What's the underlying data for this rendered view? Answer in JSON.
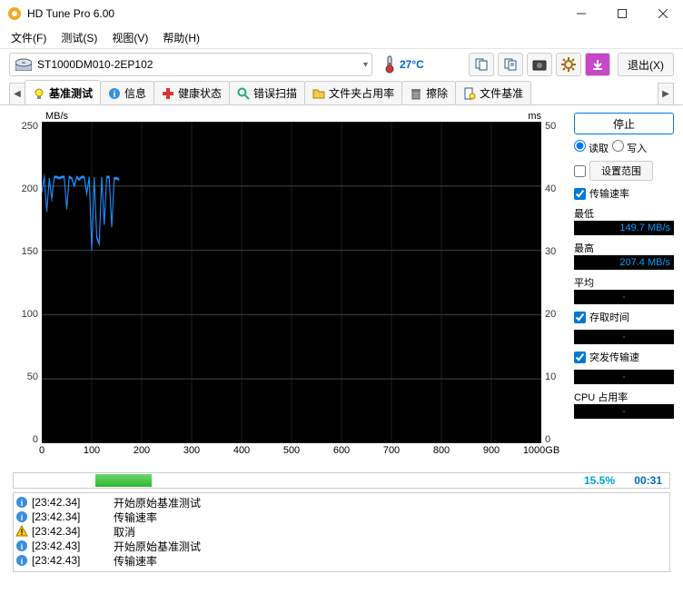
{
  "window": {
    "title": "HD Tune Pro 6.00"
  },
  "menu": [
    "文件(F)",
    "测试(S)",
    "视图(V)",
    "帮助(H)"
  ],
  "drive": "ST1000DM010-2EP102",
  "temperature": "27°C",
  "exit": "退出(X)",
  "tabs": [
    {
      "label": "基准测试",
      "active": true
    },
    {
      "label": "信息"
    },
    {
      "label": "健康状态"
    },
    {
      "label": "错误扫描"
    },
    {
      "label": "文件夹占用率"
    },
    {
      "label": "擦除"
    },
    {
      "label": "文件基准"
    }
  ],
  "chart": {
    "unit_left": "MB/s",
    "unit_right": "ms",
    "unit_x": "GB",
    "y_left": [
      "250",
      "200",
      "150",
      "100",
      "50",
      "0"
    ],
    "y_right": [
      "50",
      "40",
      "30",
      "20",
      "10",
      "0"
    ],
    "x": [
      "0",
      "100",
      "200",
      "300",
      "400",
      "500",
      "600",
      "700",
      "800",
      "900",
      "1000"
    ]
  },
  "chart_data": {
    "type": "line",
    "title": "Transfer Rate Benchmark",
    "xlabel": "GB",
    "ylabel": "MB/s",
    "ylim": [
      0,
      250
    ],
    "xlim": [
      0,
      1000
    ],
    "series": [
      {
        "name": "传输速率",
        "x": [
          0,
          5,
          10,
          15,
          20,
          25,
          30,
          35,
          40,
          45,
          50,
          55,
          60,
          65,
          70,
          75,
          80,
          85,
          90,
          95,
          100,
          105,
          110,
          115,
          120,
          125,
          130,
          135,
          140,
          145,
          150,
          155
        ],
        "values": [
          195,
          207,
          180,
          206,
          190,
          207,
          207,
          206,
          207,
          207,
          182,
          207,
          206,
          200,
          207,
          205,
          207,
          207,
          194,
          207,
          150,
          207,
          160,
          155,
          207,
          170,
          207,
          207,
          168,
          206,
          206,
          205
        ]
      }
    ]
  },
  "side": {
    "stop": "停止",
    "read": "读取",
    "write": "写入",
    "set_range": "设置范围",
    "transfer_rate": "传输速率",
    "min": "最低",
    "min_val": "149.7 MB/s",
    "max": "最高",
    "max_val": "207.4 MB/s",
    "avg": "平均",
    "avg_val": "-",
    "access": "存取时间",
    "access_val": "-",
    "burst": "突发传输速",
    "burst_val": "-",
    "cpu": "CPU 占用率",
    "cpu_val": "-"
  },
  "progress": {
    "pct": "15.5%",
    "time": "00:31",
    "value": 15.5
  },
  "log": [
    {
      "icon": "info",
      "ts": "[23:42.34]",
      "msg": "开始原始基准测试"
    },
    {
      "icon": "info",
      "ts": "[23:42.34]",
      "msg": "传输速率"
    },
    {
      "icon": "warn",
      "ts": "[23:42.34]",
      "msg": "取消"
    },
    {
      "icon": "info",
      "ts": "[23:42.43]",
      "msg": "开始原始基准测试"
    },
    {
      "icon": "info",
      "ts": "[23:42.43]",
      "msg": "传输速率"
    }
  ]
}
